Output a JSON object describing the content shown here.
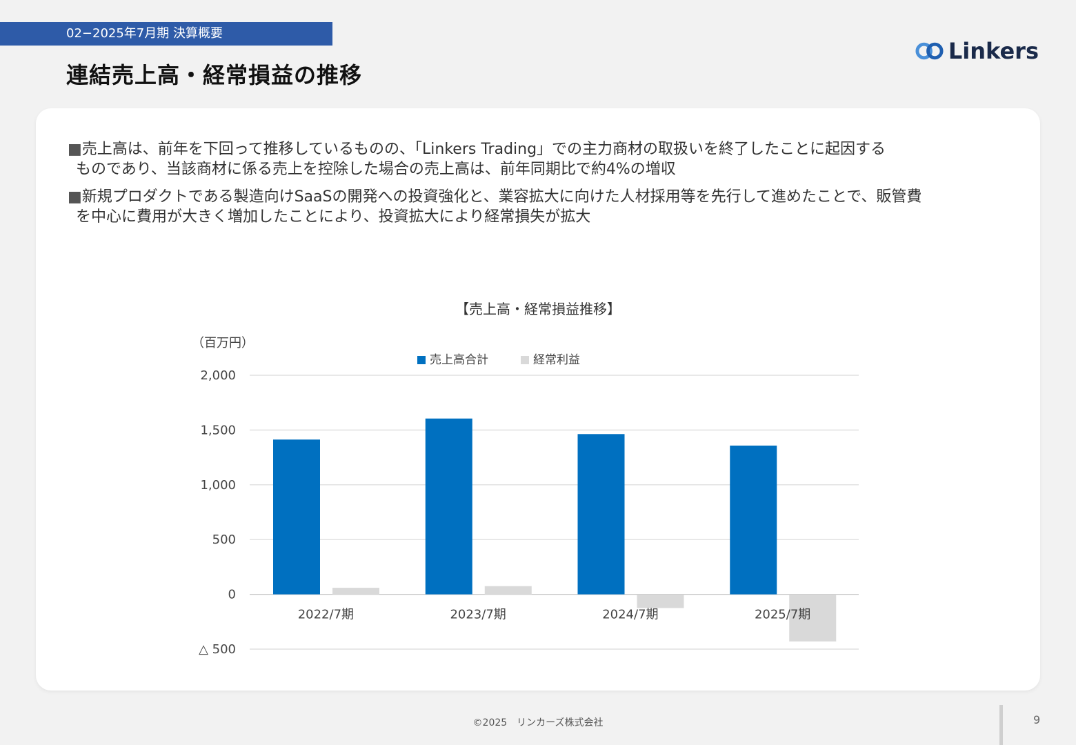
{
  "header": {
    "section": "02−2025年7月期 決算概要",
    "title": "連結売上高・経常損益の推移",
    "logo_text": "Linkers"
  },
  "bullets": [
    {
      "mark": "■",
      "line1": "売上高は、前年を下回って推移しているものの、「Linkers Trading」での主力商材の取扱いを終了したことに起因する",
      "line2": "ものであり、当該商材に係る売上を控除した場合の売上高は、前年同期比で約4%の増収"
    },
    {
      "mark": "■",
      "line1": "新規プロダクトである製造向けSaaSの開発への投資強化と、業容拡大に向けた人材採用等を先行して進めたことで、販管費",
      "line2": "を中心に費用が大きく増加したことにより、投資拡大により経常損失が拡大"
    }
  ],
  "chart_data": {
    "type": "bar",
    "title": "【売上高・経常損益推移】",
    "ylabel": "（百万円）",
    "categories": [
      "2022/7期",
      "2023/7期",
      "2024/7期",
      "2025/7期"
    ],
    "series": [
      {
        "name": "売上高合計",
        "color": "#0070c0",
        "values": [
          1413,
          1605,
          1463,
          1358
        ]
      },
      {
        "name": "経常利益",
        "color": "#d9d9d9",
        "values": [
          60,
          75,
          -125,
          -430
        ]
      }
    ],
    "ylim": [
      -500,
      2000
    ],
    "yticks": [
      {
        "value": 2000,
        "label": "2,000"
      },
      {
        "value": 1500,
        "label": "1,500"
      },
      {
        "value": 1000,
        "label": "1,000"
      },
      {
        "value": 500,
        "label": "500"
      },
      {
        "value": 0,
        "label": "0"
      },
      {
        "value": -500,
        "label": "△ 500"
      }
    ],
    "grid": true,
    "legend": "top-center"
  },
  "footer": {
    "copyright": "©2025　リンカーズ株式会社",
    "page": "9"
  },
  "colors": {
    "accent": "#2e5ba8",
    "bar_sales": "#0070c0",
    "bar_profit": "#d9d9d9"
  }
}
